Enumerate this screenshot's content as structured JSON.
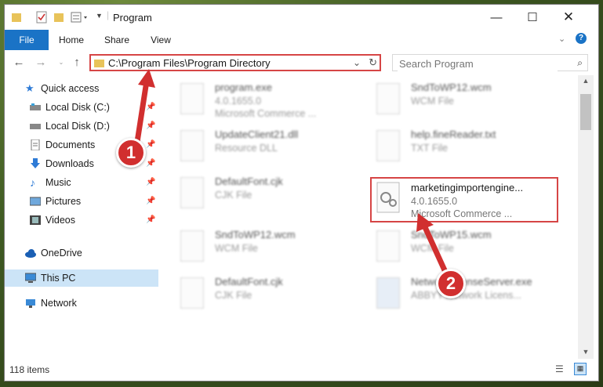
{
  "window": {
    "title": "Program",
    "minimize_icon": "minimize-icon",
    "maximize_icon": "maximize-icon",
    "close_icon": "close-icon"
  },
  "ribbon": {
    "tabs": [
      {
        "label": "File"
      },
      {
        "label": "Home"
      },
      {
        "label": "Share"
      },
      {
        "label": "View"
      }
    ]
  },
  "address": {
    "path": "C:\\Program Files\\Program Directory"
  },
  "search": {
    "placeholder": "Search Program"
  },
  "sidebar": {
    "items": [
      {
        "label": "Quick access",
        "icon": "star-icon"
      },
      {
        "label": "Local Disk (C:)",
        "icon": "drive-icon"
      },
      {
        "label": "Local Disk (D:)",
        "icon": "drive-icon"
      },
      {
        "label": "Documents",
        "icon": "documents-icon"
      },
      {
        "label": "Downloads",
        "icon": "download-icon"
      },
      {
        "label": "Music",
        "icon": "music-icon"
      },
      {
        "label": "Pictures",
        "icon": "pictures-icon"
      },
      {
        "label": "Videos",
        "icon": "videos-icon"
      },
      {
        "label": "OneDrive",
        "icon": "cloud-icon"
      },
      {
        "label": "This PC",
        "icon": "computer-icon"
      },
      {
        "label": "Network",
        "icon": "network-icon"
      }
    ]
  },
  "files": [
    {
      "name": "program.exe",
      "meta1": "4.0.1655.0",
      "meta2": "Microsoft Commerce ..."
    },
    {
      "name": "SndToWP12.wcm",
      "meta1": "WCM File",
      "meta2": ""
    },
    {
      "name": "UpdateClient21.dll",
      "meta1": "Resource DLL",
      "meta2": ""
    },
    {
      "name": "help.fineReader.txt",
      "meta1": "TXT File",
      "meta2": ""
    },
    {
      "name": "DefaultFont.cjk",
      "meta1": "CJK File",
      "meta2": ""
    },
    {
      "name": "marketingimportengine...",
      "meta1": "4.0.1655.0",
      "meta2": "Microsoft Commerce ..."
    },
    {
      "name": "SndToWP12.wcm",
      "meta1": "WCM File",
      "meta2": ""
    },
    {
      "name": "SndToWP15.wcm",
      "meta1": "WCM File",
      "meta2": ""
    },
    {
      "name": "DefaultFont.cjk",
      "meta1": "CJK File",
      "meta2": ""
    },
    {
      "name": "NetworkLicenseServer.exe",
      "meta1": "ABBYY Network Licens...",
      "meta2": ""
    }
  ],
  "status": {
    "item_count": "118 items"
  },
  "annotations": {
    "badge1": "1",
    "badge2": "2"
  },
  "colors": {
    "accent": "#1a73c6",
    "annotation_red": "#d12f2f"
  }
}
